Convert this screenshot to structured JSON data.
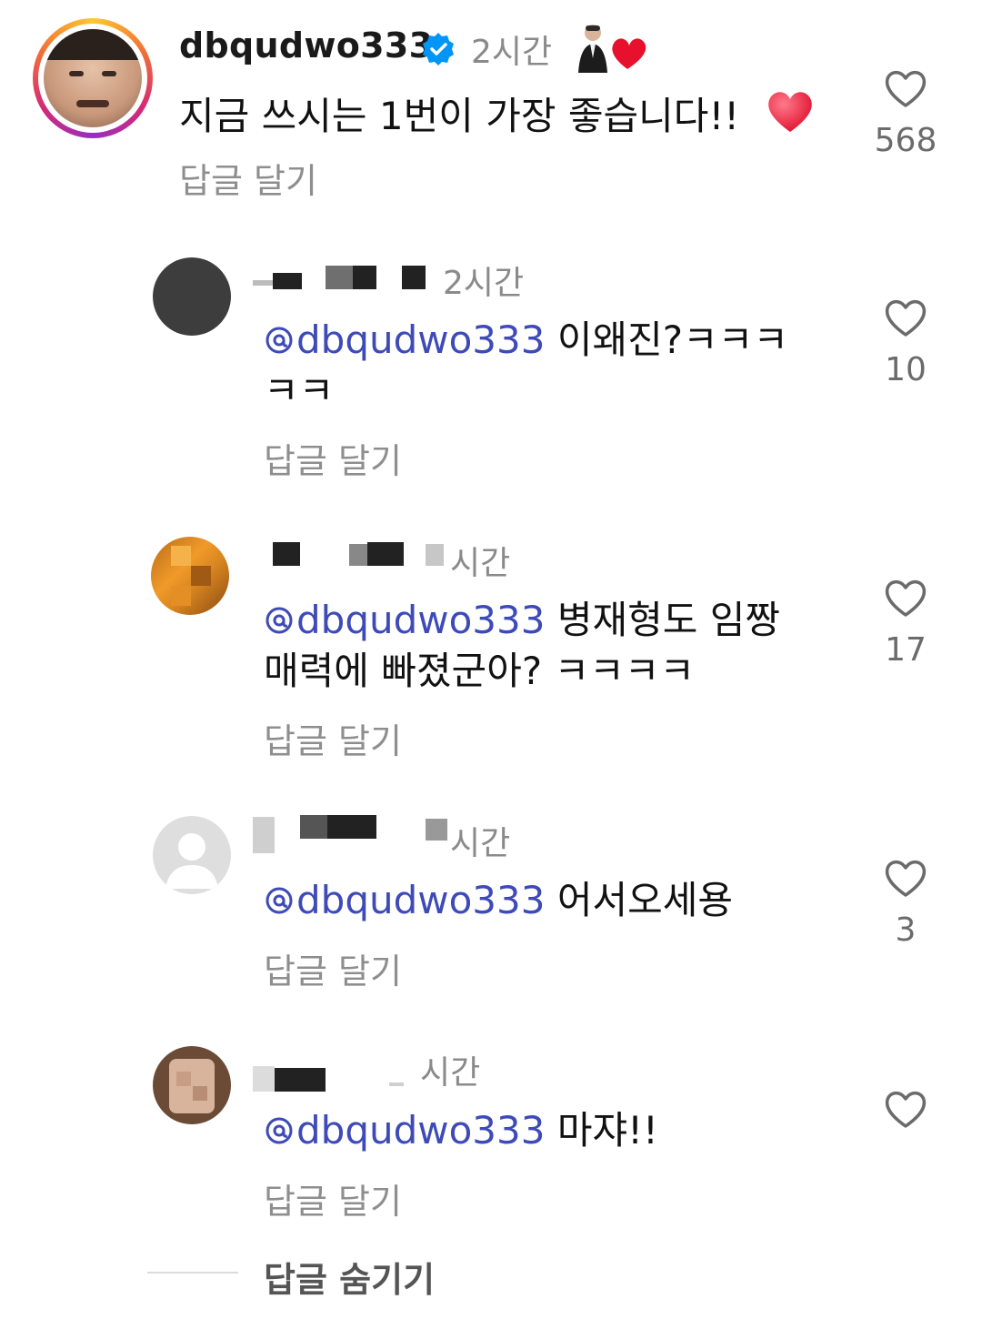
{
  "main_comment": {
    "username": "dbqudwo333",
    "time": "2시간",
    "text": "지금 쓰시는 1번이 가장 좋습니다!!",
    "reply_label": "답글 달기",
    "likes": "568"
  },
  "replies": [
    {
      "time": "2시간",
      "mention": "dbqudwo333",
      "text_line1": " 이왜진?ㅋㅋㅋ",
      "text_line2": "ㅋㅋ",
      "reply_label": "답글 달기",
      "likes": "10"
    },
    {
      "time": "시간",
      "mention": "dbqudwo333",
      "text_line1": " 병재형도 임짱",
      "text_line2": "매력에 빠졌군아? ㅋㅋㅋㅋ",
      "reply_label": "답글 달기",
      "likes": "17"
    },
    {
      "time": "시간",
      "mention": "dbqudwo333",
      "text_line1": " 어서오세용",
      "reply_label": "답글 달기",
      "likes": "3"
    },
    {
      "time": "시간",
      "mention": "dbqudwo333",
      "text_line1": " 마쟈!!",
      "reply_label": "답글 달기",
      "likes": ""
    }
  ],
  "hide_replies_label": "답글 숨기기",
  "colors": {
    "mention": "#3d4ab8",
    "verified": "#0095f6",
    "heart": "#ff3b5c"
  }
}
